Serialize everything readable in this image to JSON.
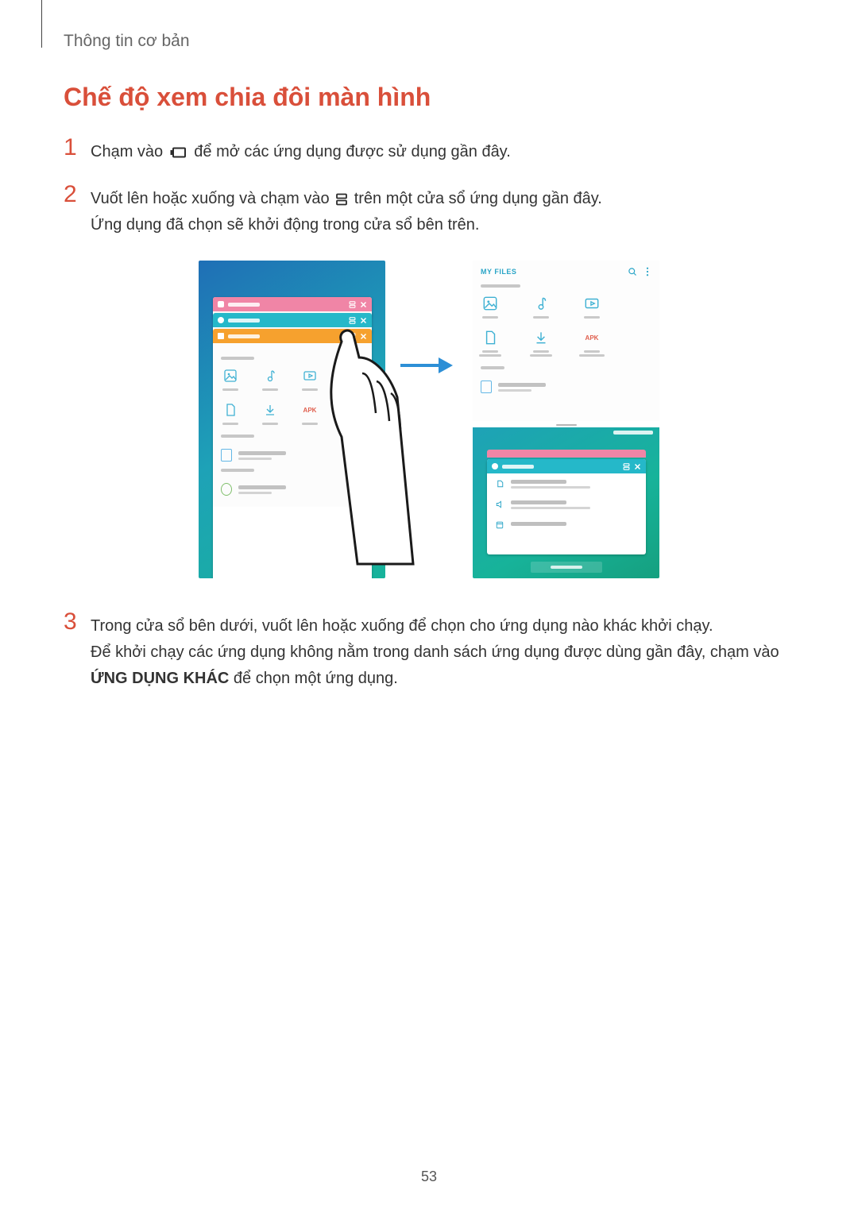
{
  "breadcrumb": "Thông tin cơ bản",
  "title": "Chế độ xem chia đôi màn hình",
  "steps": {
    "1": {
      "num": "1",
      "pre": "Chạm vào ",
      "post": " để mở các ứng dụng được sử dụng gần đây."
    },
    "2": {
      "num": "2",
      "line1_pre": "Vuốt lên hoặc xuống và chạm vào ",
      "line1_post": " trên một cửa sổ ứng dụng gần đây.",
      "line2": "Ứng dụng đã chọn sẽ khởi động trong cửa sổ bên trên."
    },
    "3": {
      "num": "3",
      "line1": "Trong cửa sổ bên dưới, vuốt lên hoặc xuống để chọn cho ứng dụng nào khác khởi chạy.",
      "line2_pre": "Để khởi chạy các ứng dụng không nằm trong danh sách ứng dụng được dùng gần đây, chạm vào ",
      "line2_strong": "ỨNG DỤNG KHÁC",
      "line2_post": " để chọn một ứng dụng."
    }
  },
  "illustration": {
    "files_title": "MY FILES",
    "apk_label": "APK"
  },
  "page_number": "53"
}
